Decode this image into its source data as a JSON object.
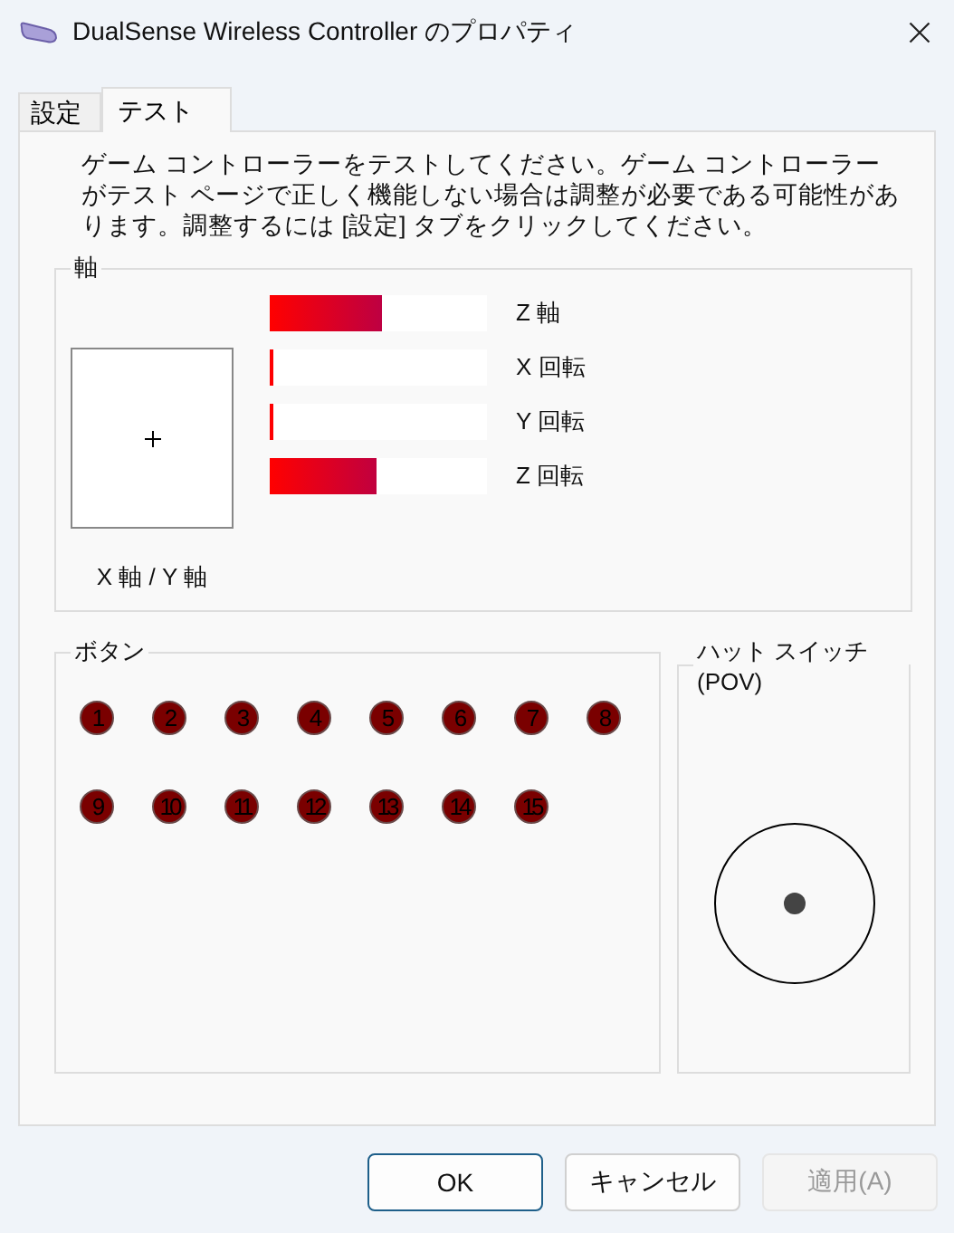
{
  "window": {
    "title": "DualSense Wireless Controller のプロパティ"
  },
  "tabs": [
    {
      "label": "設定",
      "selected": false
    },
    {
      "label": "テスト",
      "selected": true
    }
  ],
  "description": "ゲーム コントローラーをテストしてください。ゲーム コントローラーがテスト ページで正しく機能しない場合は調整が必要である可能性があります。調整するには [設定] タブをクリックしてください。",
  "axes": {
    "title": "軸",
    "xy_label": "X 軸 / Y 軸",
    "bars": [
      {
        "name": "Z 軸",
        "level": 0.52
      },
      {
        "name": "X 回転",
        "level": 0.015
      },
      {
        "name": "Y 回転",
        "level": 0.015
      },
      {
        "name": "Z 回転",
        "level": 0.49
      }
    ]
  },
  "buttons_group": {
    "title": "ボタン",
    "buttons": [
      "1",
      "2",
      "3",
      "4",
      "5",
      "6",
      "7",
      "8",
      "9",
      "10",
      "11",
      "12",
      "13",
      "14",
      "15"
    ]
  },
  "pov": {
    "title": "ハット スイッチ (POV)"
  },
  "footer_buttons": [
    {
      "label": "OK",
      "kind": "default",
      "disabled": false
    },
    {
      "label": "キャンセル",
      "kind": "normal",
      "disabled": false
    },
    {
      "label": "適用(A)",
      "kind": "normal",
      "disabled": true
    }
  ]
}
